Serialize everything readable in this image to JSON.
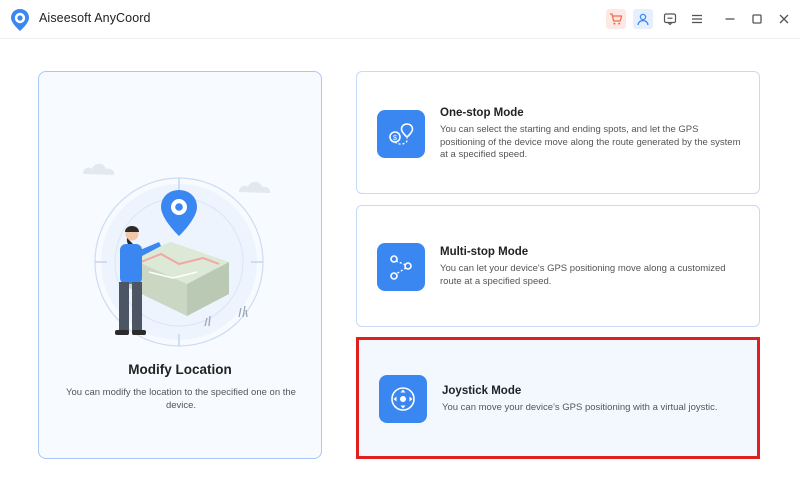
{
  "app": {
    "title": "Aiseesoft AnyCoord",
    "accent_color": "#3b87f2",
    "logo_icon": "location-pin-logo"
  },
  "titlebar": {
    "icons": [
      "cart-icon",
      "user-icon",
      "feedback-icon",
      "menu-icon",
      "minimize-icon",
      "maximize-icon",
      "close-icon"
    ]
  },
  "modify": {
    "title": "Modify Location",
    "description": "You can modify the location to the specified one on the device."
  },
  "modes": [
    {
      "title": "One-stop Mode",
      "description": "You can select the starting and ending spots, and let the GPS positioning of the device move along the route generated by the system at a specified speed.",
      "icon": "one-stop-route-icon"
    },
    {
      "title": "Multi-stop Mode",
      "description": "You can let your device's GPS positioning move along a customized route at a specified speed.",
      "icon": "multi-stop-route-icon"
    },
    {
      "title": "Joystick Mode",
      "description": "You can move your device's GPS positioning with a virtual joystic.",
      "icon": "joystick-icon",
      "highlight_color": "#e11f1f"
    }
  ]
}
